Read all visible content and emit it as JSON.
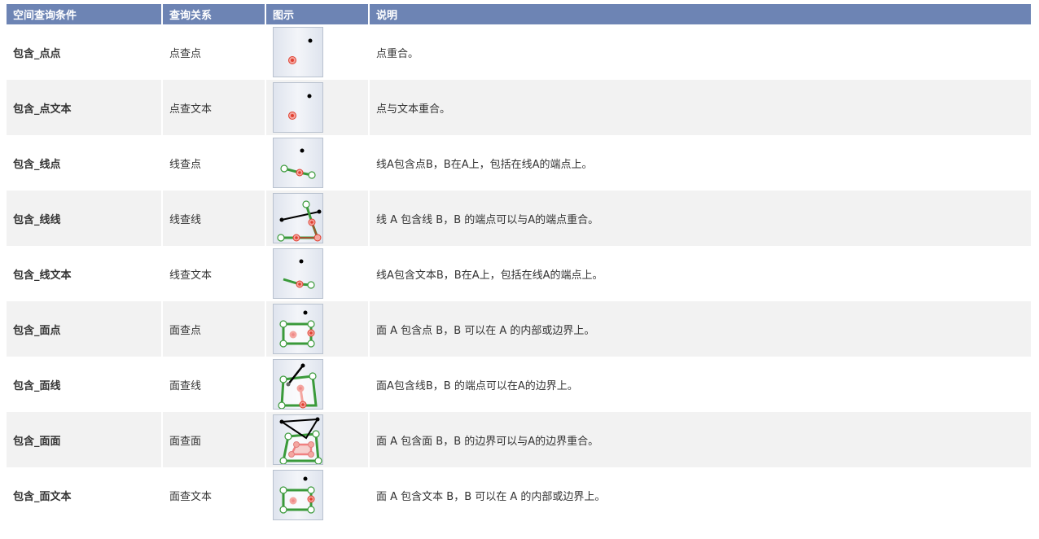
{
  "header": {
    "condition": "空间查询条件",
    "relation": "查询关系",
    "figure": "图示",
    "description": "说明"
  },
  "rows": [
    {
      "condition": "包含_点点",
      "relation": "点查点",
      "figure_icon": "point-contains-point-icon",
      "description": "点重合。"
    },
    {
      "condition": "包含_点文本",
      "relation": "点查文本",
      "figure_icon": "point-contains-text-icon",
      "description": "点与文本重合。"
    },
    {
      "condition": "包含_线点",
      "relation": "线查点",
      "figure_icon": "line-contains-point-icon",
      "description": "线A包含点B，B在A上，包括在线A的端点上。"
    },
    {
      "condition": "包含_线线",
      "relation": "线查线",
      "figure_icon": "line-contains-line-icon",
      "description": "线 A 包含线 B，B 的端点可以与A的端点重合。"
    },
    {
      "condition": "包含_线文本",
      "relation": "线查文本",
      "figure_icon": "line-contains-text-icon",
      "description": "线A包含文本B，B在A上，包括在线A的端点上。"
    },
    {
      "condition": "包含_面点",
      "relation": "面查点",
      "figure_icon": "region-contains-point-icon",
      "description": "面 A 包含点 B，B 可以在 A 的内部或边界上。"
    },
    {
      "condition": "包含_面线",
      "relation": "面查线",
      "figure_icon": "region-contains-line-icon",
      "description": "面A包含线B，B 的端点可以在A的边界上。"
    },
    {
      "condition": "包含_面面",
      "relation": "面查面",
      "figure_icon": "region-contains-region-icon",
      "description": "面 A 包含面 B，B 的边界可以与A的边界重合。"
    },
    {
      "condition": "包含_面文本",
      "relation": "面查文本",
      "figure_icon": "region-contains-text-icon",
      "description": "面 A 包含文本 B，B 可以在 A 的内部或边界上。"
    }
  ],
  "colors": {
    "header_bg": "#6d84b4",
    "row_alt_bg": "#f2f2f2",
    "green": "#3a9a3a",
    "red": "#e04030",
    "pink": "#f4a6a0"
  }
}
